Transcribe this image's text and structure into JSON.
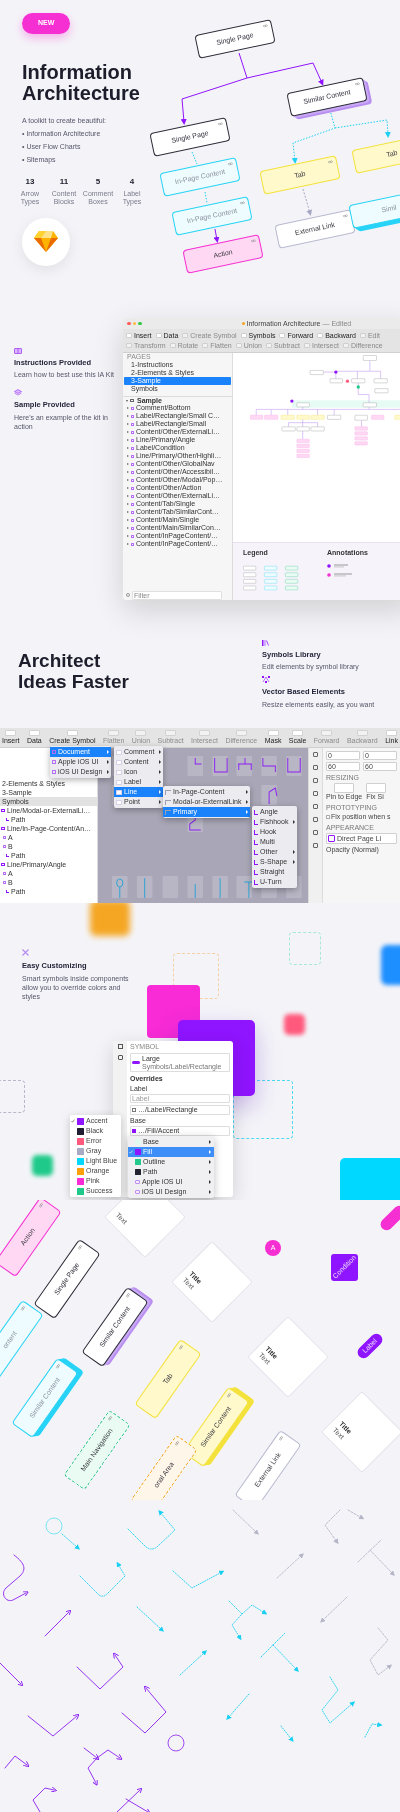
{
  "hero": {
    "badge": "NEW",
    "title": "Information Architecture",
    "intro": "A toolkit to create beautiful:",
    "bullets": [
      "• Information Architecture",
      "• User Flow Charts",
      "• Sitemaps"
    ],
    "stats": [
      {
        "value": "13",
        "label": "Arrow Types"
      },
      {
        "value": "11",
        "label": "Content Blocks"
      },
      {
        "value": "5",
        "label": "Comment Boxes"
      },
      {
        "value": "4",
        "label": "Label Types"
      }
    ],
    "flowchart": [
      {
        "label": "Single Page",
        "kind": "page"
      },
      {
        "label": "Similar Content",
        "kind": "stack"
      },
      {
        "label": "Single Page",
        "kind": "page"
      },
      {
        "label": "In-Page Content",
        "kind": "content"
      },
      {
        "label": "Tab",
        "kind": "tab"
      },
      {
        "label": "Tab",
        "kind": "tab"
      },
      {
        "label": "In-Page Content",
        "kind": "content"
      },
      {
        "label": "External Link",
        "kind": "link"
      },
      {
        "label": "Simil",
        "kind": "content-stack"
      },
      {
        "label": "Action",
        "kind": "action"
      }
    ]
  },
  "intro_features": [
    {
      "title": "Instructions Provided",
      "text": "Learn how to best use this IA Kit"
    },
    {
      "title": "Sample Provided",
      "text": "Here's an example of the kit in action"
    }
  ],
  "sketch_window": {
    "title": "Information Architecture",
    "status": "— Edited",
    "toolbar": [
      {
        "label": "Insert",
        "disabled": false
      },
      {
        "label": "Data",
        "disabled": false
      },
      {
        "label": "Create Symbol",
        "disabled": true
      },
      {
        "label": "Symbols",
        "disabled": false
      },
      {
        "label": "Forward",
        "disabled": false
      },
      {
        "label": "Backward",
        "disabled": false
      },
      {
        "label": "Edit",
        "disabled": true
      },
      {
        "label": "Transform",
        "disabled": true
      },
      {
        "label": "Rotate",
        "disabled": true
      },
      {
        "label": "Flatten",
        "disabled": true
      },
      {
        "label": "Union",
        "disabled": true
      },
      {
        "label": "Subtract",
        "disabled": true
      },
      {
        "label": "Intersect",
        "disabled": true
      },
      {
        "label": "Difference",
        "disabled": true
      }
    ],
    "pages_header": "PAGES",
    "pages": [
      {
        "label": "1-Instructions",
        "selected": false
      },
      {
        "label": "2-Elements & Styles",
        "selected": false
      },
      {
        "label": "3-Sample",
        "selected": true
      },
      {
        "label": "Symbols",
        "selected": false
      }
    ],
    "layer_group": "Sample",
    "layers": [
      "Comment/Bottom",
      "Label/Rectangle/Small C…",
      "Label/Rectangle/Small",
      "Content/Other/ExternalLi…",
      "Line/Primary/Angle",
      "Label/Condition",
      "Line/Primary/Other/Highli…",
      "Content/Other/GlobalNav",
      "Content/Other/Accessibil…",
      "Content/Other/Modal/Pop…",
      "Content/Other/Action",
      "Content/Other/ExternalLi…",
      "Content/Tab/Single",
      "Content/Tab/SimilarCont…",
      "Content/Main/Single",
      "Content/Main/SimilarCon…",
      "Content/InPageContent/…",
      "Content/InPageContent/…"
    ],
    "filter_placeholder": "Filter",
    "legend_title": "Legend",
    "annotations_title": "Annotations"
  },
  "faster": {
    "title": "Architect Ideas Faster",
    "features": [
      {
        "title": "Symbols Library",
        "text": "Edit elements by symbol library"
      },
      {
        "title": "Vector Based Elements",
        "text": "Resize elements easily, as you want"
      }
    ]
  },
  "editor": {
    "toolbar": [
      {
        "label": "Insert",
        "disabled": false
      },
      {
        "label": "Data",
        "disabled": false
      },
      {
        "label": "Create Symbol",
        "disabled": false
      },
      {
        "label": "Flatten",
        "disabled": true
      },
      {
        "label": "Union",
        "disabled": true
      },
      {
        "label": "Subtract",
        "disabled": true
      },
      {
        "label": "Intersect",
        "disabled": true
      },
      {
        "label": "Difference",
        "disabled": true
      },
      {
        "label": "Mask",
        "disabled": false
      },
      {
        "label": "Scale",
        "disabled": false
      },
      {
        "label": "Forward",
        "disabled": true
      },
      {
        "label": "Backward",
        "disabled": true
      },
      {
        "label": "Link",
        "disabled": false
      }
    ],
    "sidebar": [
      {
        "label": "2-Elements & Styles",
        "kind": "page",
        "selected": false
      },
      {
        "label": "3-Sample",
        "kind": "page",
        "selected": false
      },
      {
        "label": "Symbols",
        "kind": "page",
        "selected": true
      },
      {
        "label": "Line/Modal-or-ExternalLi…",
        "kind": "group",
        "selected": false
      },
      {
        "label": "Path",
        "kind": "path",
        "selected": false
      },
      {
        "label": "Line/In-Page-Content/An…",
        "kind": "group",
        "selected": false
      },
      {
        "label": "A",
        "kind": "symbol",
        "selected": false
      },
      {
        "label": "B",
        "kind": "symbol",
        "selected": false
      },
      {
        "label": "Path",
        "kind": "path",
        "selected": false
      },
      {
        "label": "Line/Primary/Angle",
        "kind": "group",
        "selected": false
      },
      {
        "label": "A",
        "kind": "symbol",
        "selected": false
      },
      {
        "label": "B",
        "kind": "symbol",
        "selected": false
      },
      {
        "label": "Path",
        "kind": "path",
        "selected": false
      }
    ],
    "menus": [
      {
        "items": [
          {
            "label": "Document",
            "selected": true,
            "submenu": true
          },
          {
            "label": "Apple iOS UI",
            "selected": false,
            "submenu": true
          },
          {
            "label": "iOS UI Design",
            "selected": false,
            "submenu": true
          }
        ]
      },
      {
        "items": [
          {
            "label": "Comment",
            "selected": false,
            "submenu": true
          },
          {
            "label": "Content",
            "selected": false,
            "submenu": true
          },
          {
            "label": "Icon",
            "selected": false,
            "submenu": true
          },
          {
            "label": "Label",
            "selected": false,
            "submenu": true
          },
          {
            "label": "Line",
            "selected": true,
            "submenu": true
          },
          {
            "label": "Point",
            "selected": false,
            "submenu": true
          }
        ]
      },
      {
        "items": [
          {
            "label": "In-Page-Content",
            "selected": false,
            "submenu": true
          },
          {
            "label": "Modal-or-ExternalLink",
            "selected": false,
            "submenu": true
          },
          {
            "label": "Primary",
            "selected": true,
            "submenu": true
          }
        ]
      },
      {
        "items": [
          {
            "label": "Angle",
            "selected": false,
            "submenu": false
          },
          {
            "label": "Fishhook",
            "selected": false,
            "submenu": true
          },
          {
            "label": "Hook",
            "selected": false,
            "submenu": false
          },
          {
            "label": "Multi",
            "selected": false,
            "submenu": false
          },
          {
            "label": "Other",
            "selected": false,
            "submenu": true
          },
          {
            "label": "S-Shape",
            "selected": false,
            "submenu": true
          },
          {
            "label": "Straight",
            "selected": false,
            "submenu": false
          },
          {
            "label": "U-Turn",
            "selected": false,
            "submenu": false
          }
        ]
      }
    ],
    "inspector": {
      "fields": [
        "0",
        "0",
        "60",
        "60"
      ],
      "resizing": "RESIZING",
      "pin": "Pin to Edge",
      "fix_size": "Fix Si",
      "prototyping": "PROTOTYPING",
      "fix_position": {
        "label": "Fix position when s",
        "checked": false
      },
      "appearance": "APPEARANCE",
      "style_name": "Direct Page Li",
      "opacity": "Opacity (Normal)"
    }
  },
  "customizing": {
    "title": "Easy Customizing",
    "description_lines": [
      "Smart symbols inside components",
      "allow you to override colors and styles"
    ],
    "panel": {
      "header": "SYMBOL",
      "symbol_name": "Large",
      "symbol_path": "Symbols/Label/Rectangle",
      "overrides": "Overrides",
      "label_heading": "Label",
      "label_placeholder": "Label",
      "label_style": "…/Label/Rectangle",
      "base_heading": "Base",
      "base_value": "…/Fill/Accent"
    },
    "style_menu": [
      {
        "label": "Base",
        "kind": "style",
        "color": "#e3faf1",
        "selected": false,
        "checked": false
      },
      {
        "label": "Fill",
        "kind": "style",
        "color": "#8f14ff",
        "selected": true,
        "checked": true
      },
      {
        "label": "Outline",
        "kind": "style",
        "color": "#22c98a",
        "selected": false,
        "checked": false
      },
      {
        "label": "Path",
        "kind": "style",
        "color": "#23232f",
        "selected": false,
        "checked": false
      },
      {
        "label": "Apple iOS UI",
        "kind": "library",
        "selected": false,
        "checked": false
      },
      {
        "label": "iOS UI Design",
        "kind": "library",
        "selected": false,
        "checked": false
      }
    ],
    "color_menu": [
      {
        "label": "Accent",
        "color": "#8f14ff",
        "checked": true
      },
      {
        "label": "Black",
        "color": "#1e1e32",
        "checked": false
      },
      {
        "label": "Error",
        "color": "#ff5a7d",
        "checked": false
      },
      {
        "label": "Gray",
        "color": "#a9aac4",
        "checked": false
      },
      {
        "label": "Light Blue",
        "color": "#00d8ff",
        "checked": false
      },
      {
        "label": "Orange",
        "color": "#ff9f0a",
        "checked": false
      },
      {
        "label": "Pink",
        "color": "#f82bd6",
        "checked": false
      },
      {
        "label": "Success",
        "color": "#1fc98a",
        "checked": false
      }
    ]
  },
  "cards": [
    {
      "kind": "comment",
      "text": "Text"
    },
    {
      "kind": "action",
      "label": "Action"
    },
    {
      "kind": "page",
      "label": "Single Page"
    },
    {
      "kind": "content",
      "label": "ontent"
    },
    {
      "kind": "stack",
      "label": "Similar Content"
    },
    {
      "kind": "comment",
      "title": "Title",
      "text": "Text"
    },
    {
      "kind": "circle",
      "label": "A"
    },
    {
      "kind": "condition",
      "label": "Condition"
    },
    {
      "kind": "content-stack",
      "label": "Similar Content"
    },
    {
      "kind": "tab",
      "label": "Tab"
    },
    {
      "kind": "comment",
      "title": "Title",
      "text": "Text"
    },
    {
      "kind": "pill",
      "label": "Label"
    },
    {
      "kind": "tab-stack",
      "label": "Similar Content"
    },
    {
      "kind": "navigation",
      "label": "Main Navigation"
    },
    {
      "kind": "comment",
      "title": "Title",
      "text": "Text"
    },
    {
      "kind": "link",
      "label": "External Link"
    },
    {
      "kind": "area",
      "label": "onal Area"
    }
  ]
}
